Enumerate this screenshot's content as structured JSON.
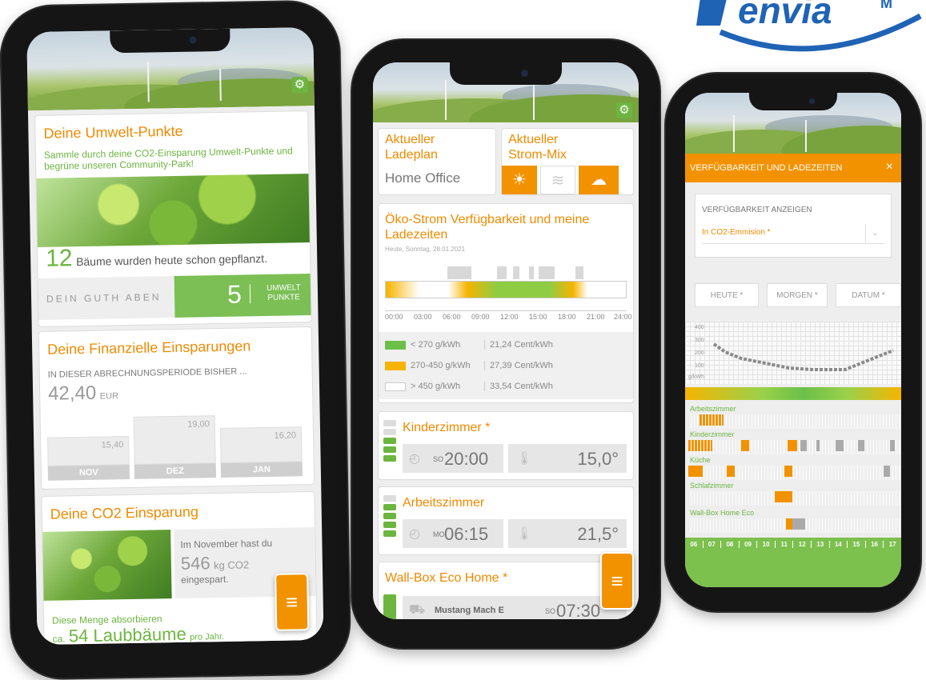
{
  "logo": {
    "text": "envia",
    "suffix": "M"
  },
  "colors": {
    "accent": "#ef8a00",
    "green": "#6cb540"
  },
  "phone1": {
    "punkte": {
      "title": "Deine Umwelt-Punkte",
      "subtitle": "Sammle durch deine CO2-Einsparung Umwelt-Punkte und begrüne unseren Community-Park!",
      "trees_count": "12",
      "trees_text": "Bäume wurden heute schon gepflanzt.",
      "guthaben_label": "DEIN GUTH ABEN",
      "points_value": "5",
      "points_label": "UMWELT PUNKTE"
    },
    "finanz": {
      "title": "Deine Finanzielle Einsparungen",
      "period_label": "IN DIESER ABRECHNUNGSPERIODE BISHER ...",
      "amount": "42,40",
      "currency": "EUR",
      "bars": [
        {
          "month": "NOV",
          "value": "15,40"
        },
        {
          "month": "DEZ",
          "value": "19,00"
        },
        {
          "month": "JAN",
          "value": "16,20"
        }
      ]
    },
    "co2": {
      "title": "Deine CO2 Einsparung",
      "intro": "Im November hast du",
      "amount": "546",
      "unit": "kg CO2",
      "suffix": "eingespart.",
      "absorb_label": "Diese Menge absorbieren",
      "ca": "ca.",
      "trees": "54 Laubbäume",
      "per_year": "pro Jahr."
    },
    "menu_icon": "hamburger-icon"
  },
  "phone2": {
    "ladeplan": {
      "title": "Aktueller Ladeplan",
      "value": "Home Office"
    },
    "strommix": {
      "title": "Aktueller Strom-Mix",
      "icons": [
        "sun-icon",
        "wind-icon",
        "cloud-icon"
      ]
    },
    "chart": {
      "title": "Öko-Strom Verfügbarkeit und meine Ladezeiten",
      "date": "Heute, Sonntag, 28.01.2021",
      "ticks": [
        "00:00",
        "03:00",
        "06:00",
        "09:00",
        "12:00",
        "15:00",
        "18:00",
        "21:00",
        "24:00"
      ],
      "legend": [
        {
          "range": "< 270 g/kWh",
          "price": "21,24 Cent/kWh",
          "color": "#6cc04a"
        },
        {
          "range": "270-450 g/kWh",
          "price": "27,39 Cent/kWh",
          "color": "#f6b400"
        },
        {
          "range": "> 450 g/kWh",
          "price": "33,54 Cent/kWh",
          "color": "#ffffff"
        }
      ]
    },
    "rooms": [
      {
        "name": "Kinderzimmer *",
        "day": "SO",
        "time": "20:00",
        "temp": "15,0°"
      },
      {
        "name": "Arbeitszimmer",
        "day": "MO",
        "time": "06:15",
        "temp": "21,5°"
      }
    ],
    "wallbox": {
      "name": "Wall-Box Eco Home *",
      "car": "Mustang Mach E",
      "day": "SO",
      "time": "07:30"
    }
  },
  "phone3": {
    "header": "VERFÜGBARKEIT UND LADEZEITEN",
    "close": "×",
    "select_label": "VERFÜGBARKEIT ANZEIGEN",
    "select_value": "In CO2-Emmision *",
    "tabs": [
      "HEUTE *",
      "MORGEN *",
      "DATUM *"
    ],
    "y_ticks": [
      "400",
      "300",
      "200",
      "100",
      "g/kWh"
    ],
    "rooms": [
      "Arbeitszimmer",
      "Kinderzimmer",
      "Küche",
      "Schlafzimmer",
      "Wall-Box Home Eco"
    ],
    "hours": [
      "06",
      "07",
      "08",
      "09",
      "10",
      "11",
      "12",
      "13",
      "14",
      "15",
      "16",
      "17"
    ]
  }
}
